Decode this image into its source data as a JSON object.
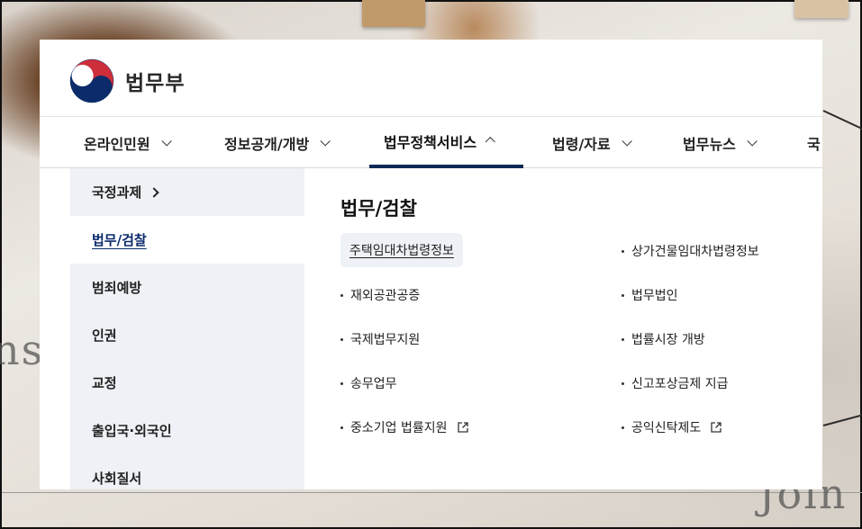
{
  "site": {
    "name": "법무부"
  },
  "gnb": [
    {
      "label": "온라인민원"
    },
    {
      "label": "정보공개/개방"
    },
    {
      "label": "법무정책서비스"
    },
    {
      "label": "법령/자료"
    },
    {
      "label": "법무뉴스"
    },
    {
      "label": "국"
    }
  ],
  "sidebar": {
    "items": [
      {
        "label": "국정과제"
      },
      {
        "label": "법무/검찰"
      },
      {
        "label": "범죄예방"
      },
      {
        "label": "인권"
      },
      {
        "label": "교정"
      },
      {
        "label": "출입국·외국인"
      },
      {
        "label": "사회질서"
      }
    ]
  },
  "content": {
    "title": "법무/검찰",
    "links_left": [
      {
        "label": "주택임대차법령정보"
      },
      {
        "label": "재외공관공증"
      },
      {
        "label": "국제법무지원"
      },
      {
        "label": "송무업무"
      },
      {
        "label": "중소기업 법률지원"
      }
    ],
    "links_right": [
      {
        "label": "상가건물임대차법령정보"
      },
      {
        "label": "법무법인"
      },
      {
        "label": "법률시장 개방"
      },
      {
        "label": "신고포상금제 지급"
      },
      {
        "label": "공익신탁제도"
      }
    ]
  },
  "colors": {
    "accent": "#0b2b55",
    "sidebar_bg": "#eef1f5",
    "highlight_text": "#0b2b6b"
  }
}
